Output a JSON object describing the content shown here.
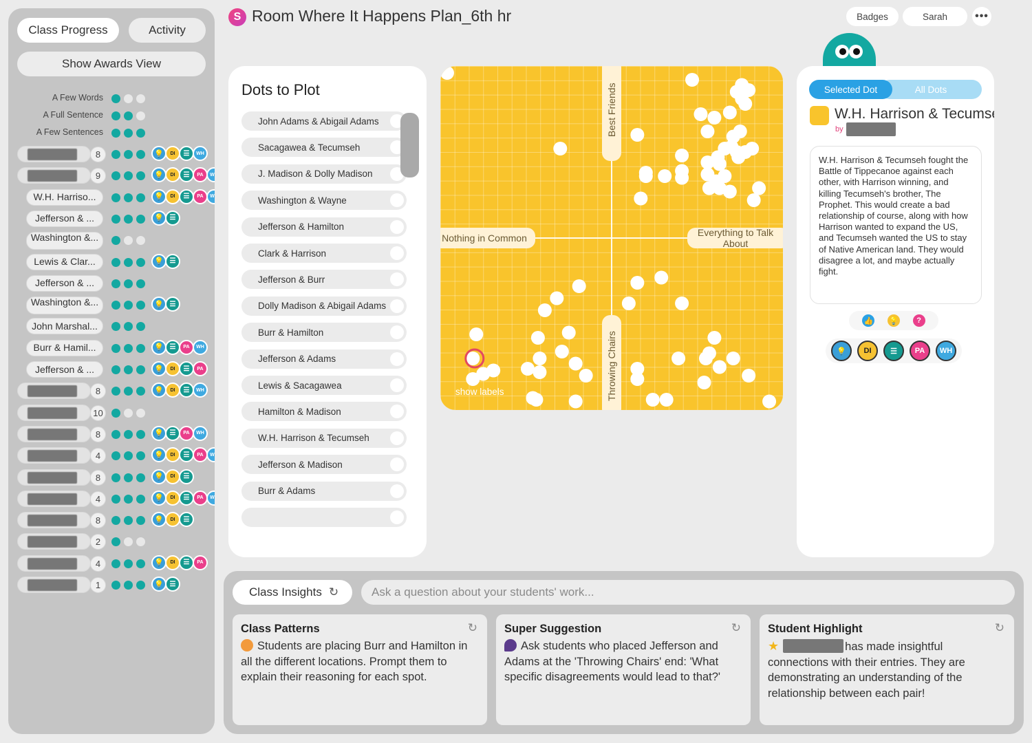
{
  "header": {
    "app_logo": "S",
    "title": "Room Where It Happens Plan_6th hr",
    "badges_label": "Badges",
    "user_label": "Sarah",
    "more_label": "•••"
  },
  "left": {
    "tab_progress": "Class Progress",
    "tab_activity": "Activity",
    "awards_button": "Show Awards View",
    "legend": [
      {
        "label": "A Few Words",
        "level": 1
      },
      {
        "label": "A Full Sentence",
        "level": 2
      },
      {
        "label": "A Few Sentences",
        "level": 3
      }
    ],
    "students": [
      {
        "name": "",
        "count": "8",
        "level": 3,
        "badges": [
          "bulb",
          "di",
          "doc",
          "wh"
        ]
      },
      {
        "name": "",
        "count": "9",
        "level": 3,
        "badges": [
          "bulb",
          "di",
          "doc",
          "pa",
          "wh"
        ]
      },
      {
        "name": "W.H. Harriso...",
        "count": "",
        "level": 3,
        "badges": [
          "bulb",
          "di",
          "doc",
          "pa",
          "wh"
        ]
      },
      {
        "name": "Jefferson & ...",
        "count": "",
        "level": 3,
        "badges": [
          "bulb",
          "doc"
        ]
      },
      {
        "name": "Washington &...",
        "count": "",
        "level": 1,
        "badges": []
      },
      {
        "name": "Lewis & Clar...",
        "count": "",
        "level": 3,
        "badges": [
          "bulb",
          "doc"
        ]
      },
      {
        "name": "Jefferson & ...",
        "count": "",
        "level": 3,
        "badges": []
      },
      {
        "name": "Washington &...",
        "count": "",
        "level": 3,
        "badges": [
          "bulb",
          "doc"
        ]
      },
      {
        "name": "John Marshal...",
        "count": "",
        "level": 3,
        "badges": []
      },
      {
        "name": "Burr & Hamil...",
        "count": "",
        "level": 3,
        "badges": [
          "bulb",
          "doc",
          "pa",
          "wh"
        ]
      },
      {
        "name": "Jefferson & ...",
        "count": "",
        "level": 3,
        "badges": [
          "bulb",
          "di",
          "doc",
          "pa"
        ]
      },
      {
        "name": "",
        "count": "8",
        "level": 3,
        "badges": [
          "bulb",
          "di",
          "doc",
          "wh"
        ]
      },
      {
        "name": "",
        "count": "10",
        "level": 1,
        "badges": []
      },
      {
        "name": "",
        "count": "8",
        "level": 3,
        "badges": [
          "bulb",
          "doc",
          "pa",
          "wh"
        ]
      },
      {
        "name": "",
        "count": "4",
        "level": 3,
        "badges": [
          "bulb",
          "di",
          "doc",
          "pa",
          "wh"
        ]
      },
      {
        "name": "",
        "count": "8",
        "level": 3,
        "badges": [
          "bulb",
          "di",
          "doc"
        ]
      },
      {
        "name": "",
        "count": "4",
        "level": 3,
        "badges": [
          "bulb",
          "di",
          "doc",
          "pa",
          "wh"
        ]
      },
      {
        "name": "",
        "count": "8",
        "level": 3,
        "badges": [
          "bulb",
          "di",
          "doc"
        ]
      },
      {
        "name": "",
        "count": "2",
        "level": 1,
        "badges": []
      },
      {
        "name": "",
        "count": "4",
        "level": 3,
        "badges": [
          "bulb",
          "di",
          "doc",
          "pa"
        ]
      },
      {
        "name": "",
        "count": "1",
        "level": 3,
        "badges": [
          "bulb",
          "doc"
        ]
      }
    ]
  },
  "badge_labels": {
    "bulb": "💡",
    "di": "DI",
    "doc": "☰",
    "pa": "PA",
    "wh": "WH"
  },
  "dots_panel": {
    "title": "Dots to Plot",
    "pairs": [
      "John Adams & Abigail Adams",
      "Sacagawea & Tecumseh",
      "J. Madison & Dolly Madison",
      "Washington & Wayne",
      "Jefferson & Hamilton",
      "Clark & Harrison",
      "Jefferson & Burr",
      "Dolly Madison & Abigail Adams",
      "Burr & Hamilton",
      "Jefferson & Adams",
      "Lewis & Sacagawea",
      "Hamilton & Madison",
      "W.H. Harrison & Tecumseh",
      "Jefferson & Madison",
      "Burr & Adams",
      ""
    ]
  },
  "plot": {
    "top_label": "Best Friends",
    "bottom_label": "Throwing Chairs",
    "left_label": "Nothing in Common",
    "right_label": "Everything to Talk About",
    "show_labels": "show labels",
    "colors": {
      "background": "#f9c42c",
      "dot": "#ffffff",
      "selected_ring": "#e3495f"
    }
  },
  "chart_data": {
    "type": "scatter",
    "xlabel_left": "Nothing in Common",
    "xlabel_right": "Everything to Talk About",
    "ylabel_top": "Best Friends",
    "ylabel_bottom": "Throwing Chairs",
    "xlim": [
      -1,
      1
    ],
    "ylim": [
      -1,
      1
    ],
    "grid": true,
    "selected": [
      -0.8,
      -0.7
    ],
    "points": [
      [
        -0.96,
        0.96
      ],
      [
        0.47,
        0.92
      ],
      [
        0.76,
        0.89
      ],
      [
        0.8,
        0.86
      ],
      [
        0.73,
        0.85
      ],
      [
        0.76,
        0.81
      ],
      [
        0.78,
        0.78
      ],
      [
        0.52,
        0.72
      ],
      [
        0.6,
        0.7
      ],
      [
        0.69,
        0.73
      ],
      [
        0.15,
        0.6
      ],
      [
        0.56,
        0.62
      ],
      [
        0.75,
        0.62
      ],
      [
        0.71,
        0.59
      ],
      [
        -0.3,
        0.52
      ],
      [
        0.7,
        0.53
      ],
      [
        0.66,
        0.52
      ],
      [
        0.73,
        0.5
      ],
      [
        0.78,
        0.5
      ],
      [
        0.62,
        0.47
      ],
      [
        0.74,
        0.47
      ],
      [
        0.82,
        0.52
      ],
      [
        0.41,
        0.48
      ],
      [
        0.56,
        0.44
      ],
      [
        0.63,
        0.43
      ],
      [
        0.2,
        0.38
      ],
      [
        0.2,
        0.36
      ],
      [
        0.31,
        0.36
      ],
      [
        0.41,
        0.39
      ],
      [
        0.41,
        0.35
      ],
      [
        0.56,
        0.37
      ],
      [
        0.66,
        0.36
      ],
      [
        0.61,
        0.33
      ],
      [
        0.57,
        0.29
      ],
      [
        0.63,
        0.29
      ],
      [
        0.69,
        0.27
      ],
      [
        0.86,
        0.29
      ],
      [
        0.83,
        0.22
      ],
      [
        0.17,
        0.23
      ],
      [
        0.15,
        -0.26
      ],
      [
        0.29,
        -0.23
      ],
      [
        -0.19,
        -0.28
      ],
      [
        -0.32,
        -0.35
      ],
      [
        0.1,
        -0.38
      ],
      [
        0.41,
        -0.38
      ],
      [
        -0.39,
        -0.42
      ],
      [
        -0.79,
        -0.56
      ],
      [
        -0.43,
        -0.58
      ],
      [
        -0.25,
        -0.55
      ],
      [
        0.6,
        -0.58
      ],
      [
        -0.42,
        -0.7
      ],
      [
        -0.29,
        -0.66
      ],
      [
        0.57,
        -0.67
      ],
      [
        0.39,
        -0.7
      ],
      [
        -0.81,
        -0.7
      ],
      [
        -0.69,
        -0.77
      ],
      [
        -0.75,
        -0.79
      ],
      [
        0.55,
        -0.7
      ],
      [
        0.71,
        -0.7
      ],
      [
        -0.49,
        -0.76
      ],
      [
        -0.42,
        -0.78
      ],
      [
        0.63,
        -0.75
      ],
      [
        -0.81,
        -0.82
      ],
      [
        -0.21,
        -0.73
      ],
      [
        0.15,
        -0.76
      ],
      [
        0.15,
        -0.82
      ],
      [
        0.8,
        -0.8
      ],
      [
        0.54,
        -0.84
      ],
      [
        -0.15,
        -0.8
      ],
      [
        -0.46,
        -0.93
      ],
      [
        -0.44,
        -0.94
      ],
      [
        -0.21,
        -0.95
      ],
      [
        0.24,
        -0.94
      ],
      [
        0.32,
        -0.94
      ],
      [
        0.92,
        -0.95
      ]
    ]
  },
  "selected_dot": {
    "tab_selected": "Selected Dot",
    "tab_all": "All Dots",
    "title": "W.H. Harrison & Tecumseh",
    "by_label": "by",
    "text": "W.H. Harrison & Tecumseh fought the Battle of Tippecanoe against each other, with Harrison winning, and killing Tecumseh's brother, The Prophet. This would create a bad relationship of course, along with how Harrison wanted to expand the US, and Tecumseh wanted the US to stay of Native American land. They would disagree a lot, and maybe actually fight.",
    "reactions": [
      "👍",
      "💡",
      "?"
    ],
    "awards": [
      "💡",
      "DI",
      "☰",
      "PA",
      "WH"
    ]
  },
  "insights": {
    "pill_label": "Class Insights",
    "ask_placeholder": "Ask a question about your students' work...",
    "cards": [
      {
        "title": "Class Patterns",
        "body": "Students are placing Burr and Hamilton in all the different locations. Prompt them to explain their reasoning for each spot."
      },
      {
        "title": "Super Suggestion",
        "body": "Ask students who placed Jefferson and Adams at the 'Throwing Chairs' end: 'What specific disagreements would lead to that?'"
      },
      {
        "title": "Student Highlight",
        "body": "has made insightful connections with their entries. They are demonstrating an understanding of the relationship between each pair!"
      }
    ]
  }
}
